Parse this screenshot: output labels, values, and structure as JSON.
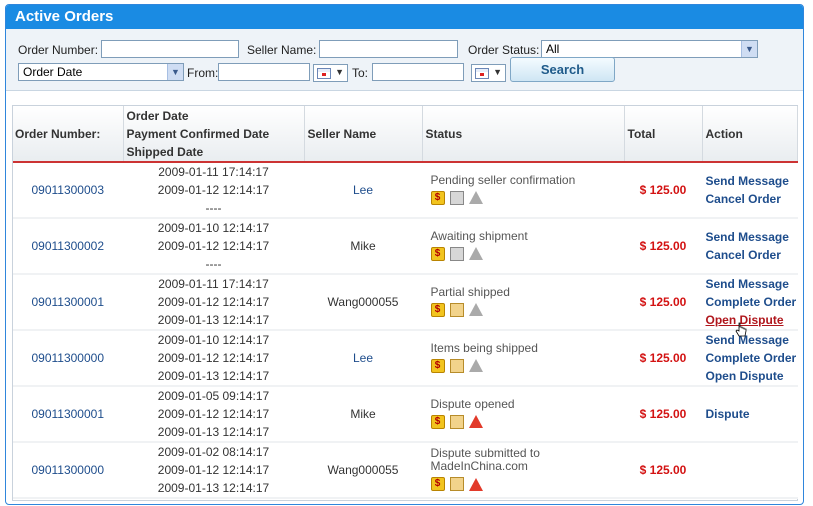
{
  "panel": {
    "title": "Active Orders"
  },
  "filters": {
    "order_number_label": "Order Number:",
    "order_number_value": "",
    "seller_name_label": "Seller Name:",
    "seller_name_value": "",
    "order_status_label": "Order Status:",
    "order_status_value": "All",
    "date_type_value": "Order Date",
    "from_label": "From:",
    "from_value": "",
    "to_label": "To:",
    "to_value": "",
    "search_label": "Search"
  },
  "table": {
    "headers": {
      "order_number": "Order Number:",
      "date_line1": "Order Date",
      "date_line2": "Payment Confirmed Date",
      "date_line3": "Shipped Date",
      "seller": "Seller Name",
      "status": "Status",
      "total": "Total",
      "action": "Action"
    },
    "rows": [
      {
        "order": "09011300003",
        "d1": "2009-01-11 17:14:17",
        "d2": "2009-01-12 12:14:17",
        "d3": "----",
        "seller": "Lee",
        "status": "Pending seller confirmation",
        "total": "$ 125.00",
        "actions": [
          "Send Message",
          "Cancel Order"
        ],
        "icons": [
          "dollar",
          "box-grey",
          "warn-grey"
        ]
      },
      {
        "order": "09011300002",
        "d1": "2009-01-10 12:14:17",
        "d2": "2009-01-12 12:14:17",
        "d3": "----",
        "seller": "Mike",
        "status": "Awaiting shipment",
        "total": "$ 125.00",
        "actions": [
          "Send Message",
          "Cancel Order"
        ],
        "icons": [
          "dollar",
          "box-grey",
          "warn-grey"
        ]
      },
      {
        "order": "09011300001",
        "d1": "2009-01-11 17:14:17",
        "d2": "2009-01-12 12:14:17",
        "d3": "2009-01-13 12:14:17",
        "seller": "Wang000055",
        "status": "Partial shipped",
        "total": "$ 125.00",
        "actions": [
          "Send Message",
          "Complete Order",
          "Open Dispute"
        ],
        "icons": [
          "dollar",
          "box-yellow",
          "warn-grey"
        ]
      },
      {
        "order": "09011300000",
        "d1": "2009-01-10 12:14:17",
        "d2": "2009-01-12 12:14:17",
        "d3": "2009-01-13 12:14:17",
        "seller": "Lee",
        "status": "Items being shipped",
        "total": "$ 125.00",
        "actions": [
          "Send Message",
          "Complete Order",
          "Open Dispute"
        ],
        "icons": [
          "dollar",
          "box-yellow",
          "warn-grey"
        ]
      },
      {
        "order": "09011300001",
        "d1": "2009-01-05 09:14:17",
        "d2": "2009-01-12 12:14:17",
        "d3": "2009-01-13 12:14:17",
        "seller": "Mike",
        "status": "Dispute opened",
        "total": "$ 125.00",
        "actions": [
          "Dispute"
        ],
        "icons": [
          "dollar",
          "box-yellow",
          "warn-red"
        ]
      },
      {
        "order": "09011300000",
        "d1": "2009-01-02 08:14:17",
        "d2": "2009-01-12 12:14:17",
        "d3": "2009-01-13 12:14:17",
        "seller": "Wang000055",
        "status": "Dispute submitted to MadeInChina.com",
        "total": "$ 125.00",
        "actions": [],
        "icons": [
          "dollar",
          "box-yellow",
          "warn-red"
        ]
      }
    ]
  },
  "colors": {
    "accent": "#1a8be3",
    "total": "#d31212",
    "link": "#1e4d8c",
    "hover_link": "#b0161c"
  }
}
